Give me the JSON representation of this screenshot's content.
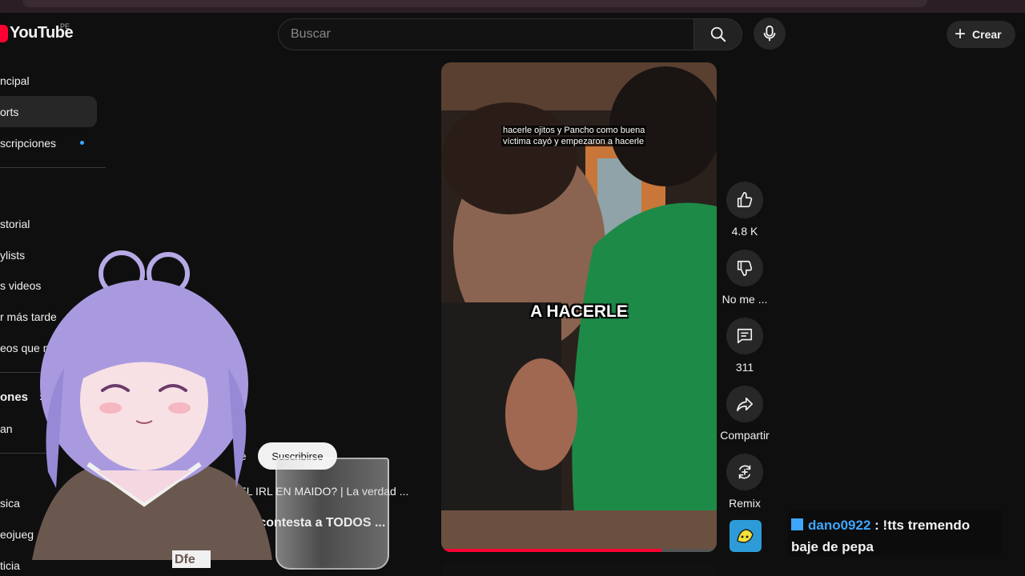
{
  "header": {
    "logo_text": "YouTube",
    "country_code": "PE",
    "search_placeholder": "Buscar",
    "create_label": "Crear"
  },
  "sidebar": {
    "items": [
      {
        "label": "ncipal"
      },
      {
        "label": "orts"
      },
      {
        "label": "scripciones"
      },
      {
        "label": "storial"
      },
      {
        "label": "ylists"
      },
      {
        "label": "s videos"
      },
      {
        "label": "r más tarde"
      },
      {
        "label": "eos que me g"
      },
      {
        "label": "ones"
      },
      {
        "label": "an"
      },
      {
        "label": "sica"
      },
      {
        "label": "eojueg"
      },
      {
        "label": "ticia"
      }
    ]
  },
  "short": {
    "caption_line1": "hacerle ojitos y Pancho como buena",
    "caption_line2": "víctima cayó y empezaron a hacerle",
    "big_caption": "A HACERLE",
    "progress": 0.8
  },
  "actions": {
    "like_count": "4.8 K",
    "dislike_label": "No me ...",
    "comment_count": "311",
    "share_label": "Compartir",
    "remix_label": "Remix"
  },
  "shelf": {
    "channel_fragment": "pe",
    "subscribe_label": "Suscribirse",
    "video_title_1": "con EL IRL EN MAIDO? | La verdad ...",
    "video_title_2": "a contesta a TODOS ..."
  },
  "chat": {
    "username": "dano0922",
    "message": ": !tts tremendo baje de pepa"
  },
  "overlay": {
    "hoodie_text": "Dfe"
  },
  "colors": {
    "accent_red": "#ff0033",
    "accent_blue": "#3ea6ff",
    "background": "#0f0f0f"
  }
}
